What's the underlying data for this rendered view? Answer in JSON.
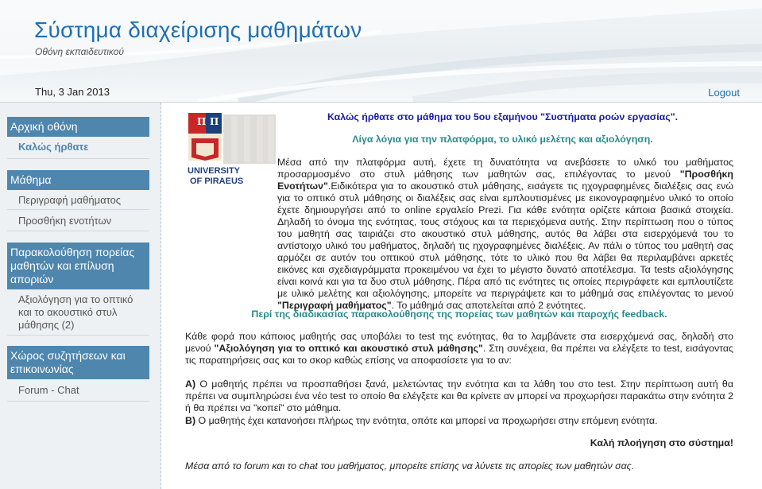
{
  "header": {
    "title": "Σύστημα διαχείρισης μαθημάτων",
    "subtitle": "Οθόνη εκπαιδευτικού",
    "date": "Thu, 3 Jan 2013",
    "logout_label": "Logout"
  },
  "sidebar": {
    "sections": [
      {
        "heading": "Αρχική οθόνη",
        "items": [
          "Καλώς ήρθατε"
        ]
      },
      {
        "heading": "Μάθημα",
        "items": [
          "Περιγραφή μαθήματος",
          "Προσθήκη ενοτήτων"
        ]
      },
      {
        "heading": "Παρακολούθηση πορείας μαθητών και επίλυση αποριών",
        "items": [
          "Αξιολόγηση για το οπτικό και το ακουστικό στυλ μάθησης (2)"
        ]
      },
      {
        "heading": "Χώρος συζητήσεων και επικοινωνίας",
        "items": [
          "Forum - Chat"
        ]
      }
    ]
  },
  "logo": {
    "alt": "University of Piraeus logo",
    "text_line1": "UNIVERSITY",
    "text_line2": "OF PIRAEUS"
  },
  "content": {
    "welcome": "Καλώς ήρθατε στο μάθημα του 5ου εξαμήνου \"Συστήματα ροών εργασίας\".",
    "intro_heading": "Λίγα λόγια για την πλατφόρμα, το υλικό μελέτης και αξιολόγηση.",
    "p1_a": "Μέσα από την πλατφόρμα αυτή, έχετε τη δυνατότητα να ανεβάσετε το υλικό του μαθήματος προσαρμοσμένο στο στυλ μάθησης των μαθητών σας, επιλέγοντας το μενού ",
    "p1_b": "\"Προσθήκη Ενοτήτων\"",
    "p1_c": ".Ειδικότερα για το ακουστικό στυλ μάθησης, εισάγετε τις ηχογραφημένες διαλέξεις σας ενώ για το οπτικό στυλ μάθησης οι διαλέξεις σας είναι εμπλουτισμένες με εικονογραφημένο υλικό το οποίο έχετε δημιουργήσει από το online εργαλείο Prezi. Για κάθε ενότητα ορίζετε κάποια βασικά στοιχεία. Δηλαδή το όνομα της ενότητας, τους στόχους και τα περιεχόμενα αυτής. Στην περίπτωση που ο τύπος του μαθητή σας ταιριάζει στο ακουστικό στυλ μάθησης, αυτός θα λάβει στα εισερχόμενά του το αντίστοιχο υλικό του μαθήματος, δηλαδή τις ηχογραφημένες διαλέξεις. Αν πάλι ο τύπος του μαθητή σας αρμόζει σε αυτόν του οπτικού στυλ μάθησης, τότε το υλικό που θα λάβει θα περιλαμβάνει αρκετές εικόνες και σχεδιαγράμματα προκειμένου να έχει το μέγιστο δυνατό αποτέλεσμα. Τα tests αξιολόγησης είναι κοινά και για τα δυο στυλ μάθησης. Πέρα από τις ενότητες τις οποίες περιγράφετε και εμπλουτίζετε με υλικό μελέτης και αξιολόγησης, μπορείτε να περιγράψετε και το μάθημά σας επιλέγοντας το μενού ",
    "p1_d": "\"Περιγραφή μαθήματος\"",
    "p1_e": ". Το μάθημά σας αποτελείται από 2 ενότητες.",
    "track_heading": "Περί της διαδικασίας παρακολούθησης της πορείας των μαθητών και παροχής feedback.",
    "p2_a": "Κάθε φορά που κάποιος μαθητής σας υποβάλει το test της ενότητας, θα το λαμβάνετε στα εισερχόμενά σας, δηλαδή στο μενού ",
    "p2_b": "\"Αξιολόγηση για το οπτικό και ακουστικό στυλ μάθησης\"",
    "p2_c": ". Στη συνέχεια, θα πρέπει να ελέγξετε το test, εισάγοντας τις παρατηρήσεις σας και το σκορ καθώς επίσης να αποφασίσετε για το αν:",
    "pA_label": "A)",
    "pA_text": " Ο μαθητής πρέπει να προσπαθήσει ξανά, μελετώντας την ενότητα και τα λάθη του στο test. Στην περίπτωση αυτή θα πρέπει να συμπληρώσει ένα νέο test το οποίο θα ελέγξετε και θα κρίνετε αν μπορεί να προχωρήσει παρακάτω στην ενότητα 2 ή θα πρέπει να \"κοπεί\" στο μάθημα.",
    "pB_label": "B)",
    "pB_text": " Ο μαθητής έχει κατανοήσει πλήρως την ενότητα, οπότε και μπορεί να προχωρήσει στην επόμενη ενότητα.",
    "goodbye": "Καλή πλοήγηση στο σύστημα!",
    "forum_note": "Μέσα από το forum και το chat του μαθήματος, μπορείτε επίσης να λύνετε τις απορίες των μαθητών σας."
  }
}
